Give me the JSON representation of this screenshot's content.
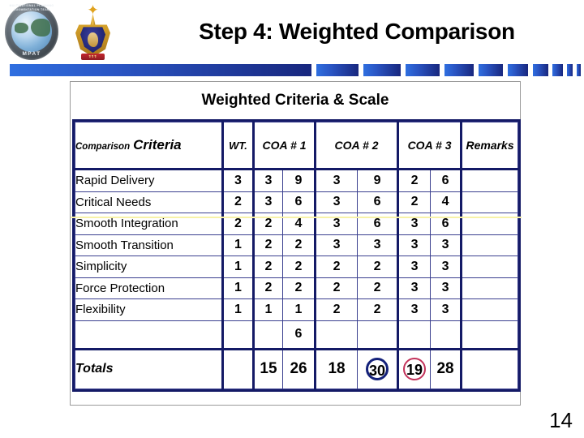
{
  "slide": {
    "title": "Step 4: Weighted Comparison",
    "page_number": "14",
    "accent_color": "#18277e"
  },
  "logos": {
    "mpat": {
      "ring_text": "MULTINATIONAL PLANNING AUGMENTATION TEAM",
      "acronym": "MPAT"
    },
    "crest": {
      "banner_text": "รรร"
    }
  },
  "table": {
    "caption": "Weighted Criteria & Scale",
    "headers": {
      "criteria_prefix": "Comparison",
      "criteria_main": "Criteria",
      "wt": "WT.",
      "coa1": "COA # 1",
      "coa2": "COA # 2",
      "coa3": "COA # 3",
      "remarks": "Remarks"
    },
    "rows": [
      {
        "criteria": "Rapid Delivery",
        "wt": "3",
        "coa1_score": "3",
        "coa1_weighted": "9",
        "coa2_score": "3",
        "coa2_weighted": "9",
        "coa3_score": "2",
        "coa3_weighted": "6",
        "remarks": ""
      },
      {
        "criteria": "Critical Needs",
        "wt": "2",
        "coa1_score": "3",
        "coa1_weighted": "6",
        "coa2_score": "3",
        "coa2_weighted": "6",
        "coa3_score": "2",
        "coa3_weighted": "4",
        "remarks": ""
      },
      {
        "criteria": "Smooth Integration",
        "wt": "2",
        "coa1_score": "2",
        "coa1_weighted": "4",
        "coa2_score": "3",
        "coa2_weighted": "6",
        "coa3_score": "3",
        "coa3_weighted": "6",
        "remarks": ""
      },
      {
        "criteria": "Smooth Transition",
        "wt": "1",
        "coa1_score": "2",
        "coa1_weighted": "2",
        "coa2_score": "3",
        "coa2_weighted": "3",
        "coa3_score": "3",
        "coa3_weighted": "3",
        "remarks": ""
      },
      {
        "criteria": "Simplicity",
        "wt": "1",
        "coa1_score": "2",
        "coa1_weighted": "2",
        "coa2_score": "2",
        "coa2_weighted": "2",
        "coa3_score": "3",
        "coa3_weighted": "3",
        "remarks": ""
      },
      {
        "criteria": "Force Protection",
        "wt": "1",
        "coa1_score": "2",
        "coa1_weighted": "2",
        "coa2_score": "2",
        "coa2_weighted": "2",
        "coa3_score": "3",
        "coa3_weighted": "3",
        "remarks": ""
      },
      {
        "criteria": "Flexibility",
        "wt": "1",
        "coa1_score": "1",
        "coa1_weighted": "1",
        "coa2_score": "2",
        "coa2_weighted": "2",
        "coa3_score": "3",
        "coa3_weighted": "3",
        "remarks": ""
      }
    ],
    "blank_row": {
      "criteria": "",
      "wt": "",
      "coa1_score": "",
      "coa1_weighted": "6",
      "coa2_score": "",
      "coa2_weighted": "",
      "coa3_score": "",
      "coa3_weighted": "",
      "remarks": ""
    },
    "totals": {
      "label": "Totals",
      "wt": "",
      "coa1_score": "15",
      "coa1_weighted": "26",
      "coa2_score": "18",
      "coa2_weighted": "30",
      "coa3_score": "19",
      "coa3_weighted": "28",
      "remarks": "",
      "highlight_coa2_weighted_color": "#14217a",
      "highlight_coa3_score_color": "#c3325a"
    }
  }
}
